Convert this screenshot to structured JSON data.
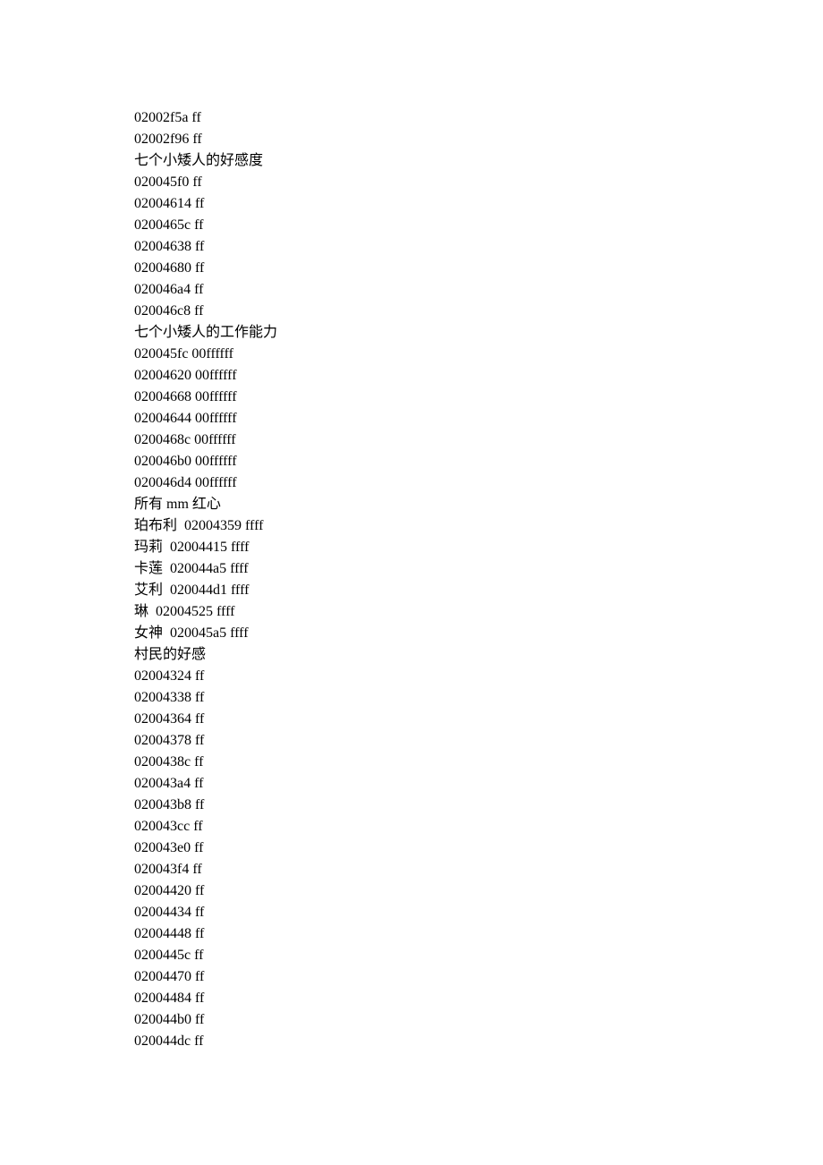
{
  "lines": [
    "02002f5a ff",
    "02002f96 ff",
    "七个小矮人的好感度",
    "020045f0 ff",
    "02004614 ff",
    "0200465c ff",
    "02004638 ff",
    "02004680 ff",
    "020046a4 ff",
    "020046c8 ff",
    "七个小矮人的工作能力",
    "020045fc 00ffffff",
    "02004620 00ffffff",
    "02004668 00ffffff",
    "02004644 00ffffff",
    "0200468c 00ffffff",
    "020046b0 00ffffff",
    "020046d4 00ffffff",
    "所有 mm 红心",
    "珀布利  02004359 ffff",
    "玛莉  02004415 ffff",
    "卡莲  020044a5 ffff",
    "艾利  020044d1 ffff",
    "琳  02004525 ffff",
    "女神  020045a5 ffff",
    "村民的好感",
    "02004324 ff",
    "02004338 ff",
    "02004364 ff",
    "02004378 ff",
    "0200438c ff",
    "020043a4 ff",
    "020043b8 ff",
    "020043cc ff",
    "020043e0 ff",
    "020043f4 ff",
    "02004420 ff",
    "02004434 ff",
    "02004448 ff",
    "0200445c ff",
    "02004470 ff",
    "02004484 ff",
    "020044b0 ff",
    "020044dc ff"
  ]
}
